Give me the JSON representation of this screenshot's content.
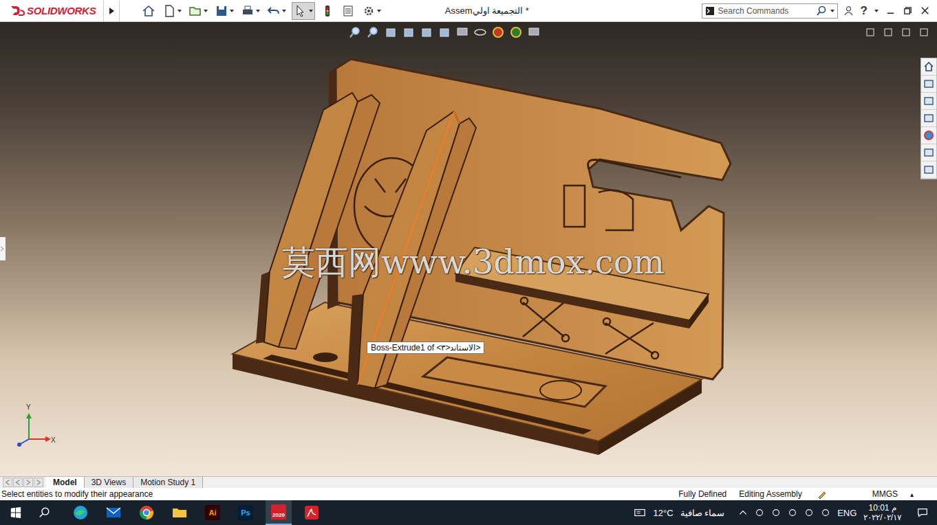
{
  "app": {
    "logo": "SOLIDWORKS",
    "title": "Assemالتجميعة اولي *"
  },
  "search": {
    "placeholder": "Search Commands"
  },
  "help": "?",
  "tooltip": "Boss-Extrude1 of <الاستاند<٣>",
  "watermark": "莫西网www.3dmox.com",
  "triad": {
    "y": "Y",
    "x": "X"
  },
  "tabs": [
    {
      "label": "Model",
      "selected": true
    },
    {
      "label": "3D Views",
      "selected": false
    },
    {
      "label": "Motion Study 1",
      "selected": false
    }
  ],
  "status_bar": {
    "message": "Select entities to modify their appearance",
    "items": [
      "Fully Defined",
      "Editing Assembly"
    ],
    "units": "MMGS",
    "units_arrow": "▴"
  },
  "taskbar": {
    "apps": [
      {
        "kind": "edge",
        "label": "",
        "active": false
      },
      {
        "kind": "mail",
        "label": "",
        "active": false
      },
      {
        "kind": "chrome",
        "label": "",
        "active": false
      },
      {
        "kind": "folder",
        "label": "",
        "active": false
      },
      {
        "kind": "illustrator",
        "label": "Ai",
        "active": false
      },
      {
        "kind": "photoshop",
        "label": "Ps",
        "active": false
      },
      {
        "kind": "solidworks",
        "label": "2020",
        "active": true
      },
      {
        "kind": "acrobat",
        "label": "",
        "active": false
      }
    ],
    "weather": {
      "temp": "12°C",
      "text": "سماء صافية"
    },
    "lang": "ENG",
    "clock": {
      "time": "10:01 م",
      "date": "٢٠٢٢/٠٢/١٧"
    }
  }
}
